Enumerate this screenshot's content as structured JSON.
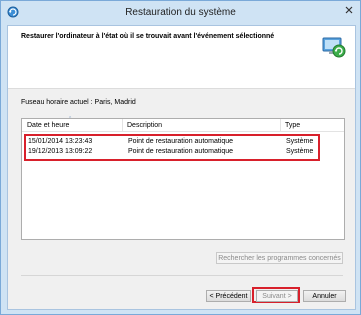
{
  "window": {
    "title": "Restauration du système"
  },
  "header": {
    "text": "Restaurer l'ordinateur à l'état où il se trouvait avant l'événement sélectionné"
  },
  "timezone": {
    "label": "Fuseau horaire actuel : Paris, Madrid"
  },
  "table": {
    "columns": [
      "Date et heure",
      "Description",
      "Type"
    ],
    "rows": [
      {
        "date": "15/01/2014 13:23:43",
        "description": "Point de restauration automatique",
        "type": "Système"
      },
      {
        "date": "19/12/2013 13:09:22",
        "description": "Point de restauration automatique",
        "type": "Système"
      }
    ]
  },
  "buttons": {
    "scan": "Rechercher les programmes concernés",
    "previous": "< Précédent",
    "next": "Suivant >",
    "cancel": "Annuler"
  },
  "colors": {
    "highlight": "#d8202b",
    "frame": "#cfe3f4"
  }
}
